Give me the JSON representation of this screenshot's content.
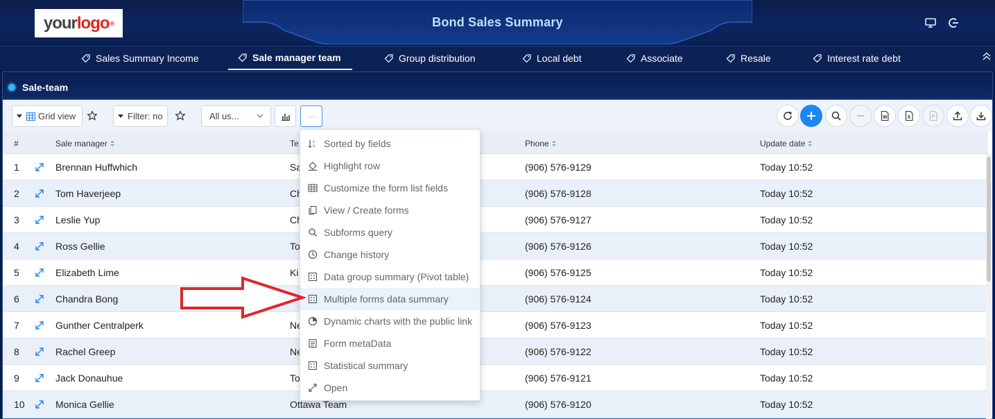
{
  "header": {
    "logo": {
      "your": "your",
      "logo": "logo",
      "reg": "®"
    },
    "title": "Bond Sales Summary",
    "icons": [
      "monitor-icon",
      "logout-icon"
    ]
  },
  "nav": {
    "tabs": [
      {
        "label": "Sales Summary Income",
        "active": false
      },
      {
        "label": "Sale manager team",
        "active": true
      },
      {
        "label": "Group distribution",
        "active": false
      },
      {
        "label": "Local debt",
        "active": false
      },
      {
        "label": "Associate",
        "active": false
      },
      {
        "label": "Resale",
        "active": false
      },
      {
        "label": "Interest rate debt",
        "active": false
      }
    ]
  },
  "panel": {
    "title": "Sale-team"
  },
  "toolbar": {
    "view_label": "Grid view",
    "filter_label": "Filter: no",
    "user_select": "All us...",
    "more_label": "···",
    "right_icons": [
      "refresh-icon",
      "add-icon",
      "search-icon",
      "minus-icon",
      "word-export-icon",
      "excel-export-icon",
      "pdf-export-icon",
      "upload-icon",
      "download-icon"
    ]
  },
  "table": {
    "columns": [
      "#",
      "Sale manager",
      "Te",
      "Phone",
      "Update date"
    ],
    "rows": [
      {
        "num": "1",
        "manager": "Brennan Huffwhich",
        "team": "Sa",
        "phone": "(906) 576-9129",
        "date": "Today 10:52"
      },
      {
        "num": "2",
        "manager": "Tom Haverjeep",
        "team": "Ch",
        "phone": "(906) 576-9128",
        "date": "Today 10:52"
      },
      {
        "num": "3",
        "manager": "Leslie Yup",
        "team": "Ch",
        "phone": "(906) 576-9127",
        "date": "Today 10:52"
      },
      {
        "num": "4",
        "manager": "Ross Gellie",
        "team": "To",
        "phone": "(906) 576-9126",
        "date": "Today 10:52"
      },
      {
        "num": "5",
        "manager": "Elizabeth Lime",
        "team": "Ki",
        "phone": "(906) 576-9125",
        "date": "Today 10:52"
      },
      {
        "num": "6",
        "manager": "Chandra Bong",
        "team": "",
        "phone": "(906) 576-9124",
        "date": "Today 10:52"
      },
      {
        "num": "7",
        "manager": "Gunther Centralperk",
        "team": "Ne",
        "phone": "(906) 576-9123",
        "date": "Today 10:52"
      },
      {
        "num": "8",
        "manager": "Rachel Greep",
        "team": "Ne",
        "phone": "(906) 576-9122",
        "date": "Today 10:52"
      },
      {
        "num": "9",
        "manager": "Jack Donauhue",
        "team": "To",
        "phone": "(906) 576-9121",
        "date": "Today 10:52"
      },
      {
        "num": "10",
        "manager": "Monica Gellie",
        "team": "Ottawa Team",
        "phone": "(906) 576-9120",
        "date": "Today 10:52"
      }
    ]
  },
  "menu": {
    "items": [
      {
        "label": "Sorted by fields",
        "icon": "sort-icon"
      },
      {
        "label": "Highlight row",
        "icon": "paint-bucket-icon"
      },
      {
        "label": "Customize the form list fields",
        "icon": "table-icon"
      },
      {
        "label": "View / Create forms",
        "icon": "copy-icon"
      },
      {
        "label": "Subforms query",
        "icon": "search-icon"
      },
      {
        "label": "Change history",
        "icon": "history-icon"
      },
      {
        "label": "Data group summary (Pivot table)",
        "icon": "calculator-icon"
      },
      {
        "label": "Multiple forms data summary",
        "icon": "calculator-icon"
      },
      {
        "label": "Dynamic charts with the public link",
        "icon": "pie-chart-icon"
      },
      {
        "label": "Form metaData",
        "icon": "document-icon"
      },
      {
        "label": "Statistical summary",
        "icon": "calculator-icon"
      },
      {
        "label": "Open",
        "icon": "expand-icon"
      }
    ],
    "highlighted_index": 7
  },
  "colors": {
    "header_bg": "#0b1d4a",
    "accent": "#1f86ef",
    "arrow": "#e0252b",
    "row_alt": "#eaf0fa"
  }
}
